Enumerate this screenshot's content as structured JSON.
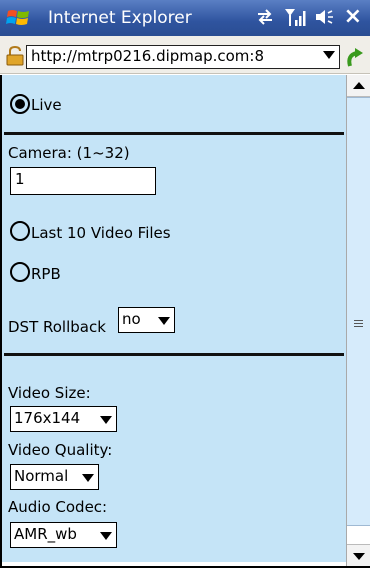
{
  "window": {
    "title": "Internet Explorer",
    "icons": [
      "windows-flag-icon",
      "sync-icon",
      "signal-icon",
      "volume-icon",
      "close-icon"
    ],
    "close_glyph": "×"
  },
  "address_bar": {
    "url": "http://mtrp0216.dipmap.com:8",
    "lock_icon": "lock-icon",
    "go_icon": "go-arrow-icon"
  },
  "form": {
    "live_label": "Live",
    "camera_label": "Camera: (1~32)",
    "camera_value": "1",
    "last10_label": "Last 10 Video Files",
    "rpb_label": "RPB",
    "dst_label": "DST Rollback",
    "dst_value": "no",
    "video_size_label": "Video Size:",
    "video_size_value": "176x144",
    "video_quality_label": "Video Quality:",
    "video_quality_value": "Normal",
    "audio_codec_label": "Audio Codec:",
    "audio_codec_value": "AMR_wb",
    "selected_mode": "Live"
  },
  "colors": {
    "titlebar": "#2f549f",
    "content_bg": "#c5e4f7",
    "scroll_thumb": "#d6ebfb"
  }
}
